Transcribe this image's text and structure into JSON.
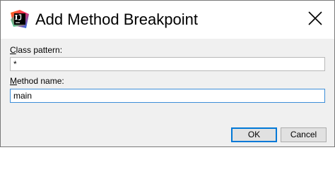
{
  "window": {
    "title": "Add Method Breakpoint"
  },
  "form": {
    "class_pattern": {
      "label_mnemonic": "C",
      "label_rest": "lass pattern:",
      "value": "*"
    },
    "method_name": {
      "label_mnemonic": "M",
      "label_rest": "ethod name:",
      "value": "main"
    }
  },
  "buttons": {
    "ok_label": "OK",
    "cancel_label": "Cancel"
  },
  "icons": {
    "app": "intellij-app-icon",
    "close": "close-icon"
  },
  "colors": {
    "focus_border": "#3c8ed8",
    "default_button_border": "#0078d7",
    "dialog_background": "#f0f0f0"
  }
}
